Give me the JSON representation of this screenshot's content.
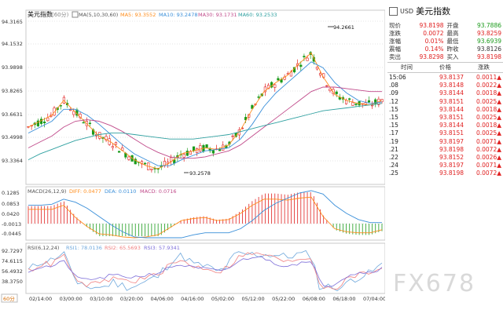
{
  "window": {
    "symbol": "USD",
    "name": "美元指数",
    "period_label": "60分"
  },
  "main_chart": {
    "title": "美元指数",
    "period": "(60分)",
    "ma_legend": "MA(5,10,30,60)",
    "ma5": "MA5: 93.3552",
    "ma10": "MA10: 93.2478",
    "ma30": "MA30: 93.1731",
    "ma60": "MA60: 93.2533",
    "high_mark": "94.2661",
    "low_mark": "93.2578",
    "y_ticks": [
      "94.3165",
      "94.1532",
      "93.9898",
      "93.8265",
      "93.6631",
      "93.4998",
      "93.3364"
    ]
  },
  "macd_chart": {
    "legend": "MACD(26,12,9)",
    "diff": "DIFF: 0.0477",
    "dea": "DEA: 0.0110",
    "macd": "MACD: 0.0716",
    "y_ticks": [
      "0.1285",
      "0.0853",
      "0.0420",
      "-0.0013",
      "-0.0445"
    ]
  },
  "rsi_chart": {
    "legend": "RSI(6,12,24)",
    "rsi1": "RSI1: 78.0136",
    "rsi2": "RSI2: 65.5693",
    "rsi3": "RSI3: 57.9341",
    "y_ticks": [
      "92.7297",
      "74.6115",
      "56.4932",
      "38.3750"
    ]
  },
  "x_axis": {
    "labels": [
      "02/14:00",
      "03/00:00",
      "03/10:00",
      "03/20:00",
      "04/06:00",
      "04/16:00",
      "05/02:00",
      "05/12:00",
      "05/22:00",
      "06/08:00",
      "06/18:00",
      "07/04:00"
    ]
  },
  "quote": {
    "rows": [
      {
        "l1": "现价",
        "v1": "93.8198",
        "c1": "up",
        "l2": "开盘",
        "v2": "93.7886",
        "c2": "dn"
      },
      {
        "l1": "涨跌",
        "v1": "0.0072",
        "c1": "up",
        "l2": "最高",
        "v2": "93.8259",
        "c2": "up"
      },
      {
        "l1": "涨幅",
        "v1": "0.01%",
        "c1": "up",
        "l2": "最低",
        "v2": "93.6939",
        "c2": "dn"
      },
      {
        "l1": "震幅",
        "v1": "0.14%",
        "c1": "up",
        "l2": "昨收",
        "v2": "93.8126",
        "c2": "lbl"
      },
      {
        "l1": "卖出",
        "v1": "93.8298",
        "c1": "up",
        "l2": "买入",
        "v2": "93.8198",
        "c2": "up"
      }
    ]
  },
  "trades": {
    "headers": [
      "时间",
      "价格",
      "涨跌"
    ],
    "rows": [
      {
        "time": "15:06",
        "price": "93.8137",
        "chg": "0.0011▲"
      },
      {
        "time": ".08",
        "price": "93.8148",
        "chg": "0.0022▲"
      },
      {
        "time": ".09",
        "price": "93.8144",
        "chg": "0.0018▲"
      },
      {
        "time": ".12",
        "price": "93.8151",
        "chg": "0.0025▲"
      },
      {
        "time": ".15",
        "price": "93.8144",
        "chg": "0.0018▲"
      },
      {
        "time": ".15",
        "price": "93.8151",
        "chg": "0.0025▲"
      },
      {
        "time": ".15",
        "price": "93.8144",
        "chg": "0.0018▲"
      },
      {
        "time": ".17",
        "price": "93.8151",
        "chg": "0.0025▲"
      },
      {
        "time": ".19",
        "price": "93.8197",
        "chg": "0.0071▲"
      },
      {
        "time": ".21",
        "price": "93.8198",
        "chg": "0.0072▲"
      },
      {
        "time": ".22",
        "price": "93.8152",
        "chg": "0.0026▲"
      },
      {
        "time": ".24",
        "price": "93.8197",
        "chg": "0.0071▲"
      },
      {
        "time": ".25",
        "price": "93.8198",
        "chg": "0.0072▲"
      }
    ]
  },
  "watermark": "FX678",
  "colors": {
    "up": "#e02020",
    "down": "#1a9a1a",
    "ma5": "#ff8c1a",
    "ma10": "#3a8fd9",
    "ma30": "#c04a8a",
    "ma60": "#2ea0a0",
    "diff": "#ff8c1a",
    "dea": "#3a8fd9",
    "rsi1": "#6fa8dc",
    "rsi2": "#f08080",
    "rsi3": "#7e6fd9"
  },
  "chart_data": {
    "type": "line",
    "title": "美元指数",
    "xlabel": "",
    "ylabel": "",
    "ylim": [
      93.25,
      94.35
    ],
    "series": [
      {
        "name": "MA5",
        "values": [
          93.62,
          93.66,
          93.7,
          93.8,
          93.72,
          93.64,
          93.56,
          93.52,
          93.46,
          93.4,
          93.36,
          93.34,
          93.38,
          93.44,
          93.46,
          93.48,
          93.47,
          93.5,
          93.6,
          93.74,
          93.86,
          93.92,
          93.97,
          94.05,
          94.12,
          93.96,
          93.84,
          93.8,
          93.78,
          93.77,
          93.8
        ]
      },
      {
        "name": "MA10",
        "values": [
          93.58,
          93.62,
          93.66,
          93.74,
          93.74,
          93.7,
          93.64,
          93.57,
          93.5,
          93.44,
          93.4,
          93.36,
          93.36,
          93.4,
          93.43,
          93.46,
          93.47,
          93.48,
          93.54,
          93.64,
          93.76,
          93.85,
          93.92,
          93.99,
          94.06,
          94.02,
          93.92,
          93.85,
          93.8,
          93.78,
          93.79
        ]
      },
      {
        "name": "MA30",
        "values": [
          93.48,
          93.52,
          93.56,
          93.62,
          93.66,
          93.67,
          93.66,
          93.63,
          93.59,
          93.54,
          93.49,
          93.45,
          93.42,
          93.41,
          93.41,
          93.42,
          93.44,
          93.46,
          93.5,
          93.56,
          93.62,
          93.68,
          93.74,
          93.8,
          93.86,
          93.89,
          93.89,
          93.88,
          93.87,
          93.86,
          93.86
        ]
      },
      {
        "name": "MA60",
        "values": [
          93.4,
          93.44,
          93.47,
          93.5,
          93.53,
          93.55,
          93.57,
          93.58,
          93.58,
          93.57,
          93.56,
          93.55,
          93.54,
          93.54,
          93.54,
          93.55,
          93.56,
          93.57,
          93.59,
          93.61,
          93.63,
          93.65,
          93.67,
          93.69,
          93.71,
          93.73,
          93.74,
          93.75,
          93.76,
          93.77,
          93.78
        ]
      }
    ]
  }
}
